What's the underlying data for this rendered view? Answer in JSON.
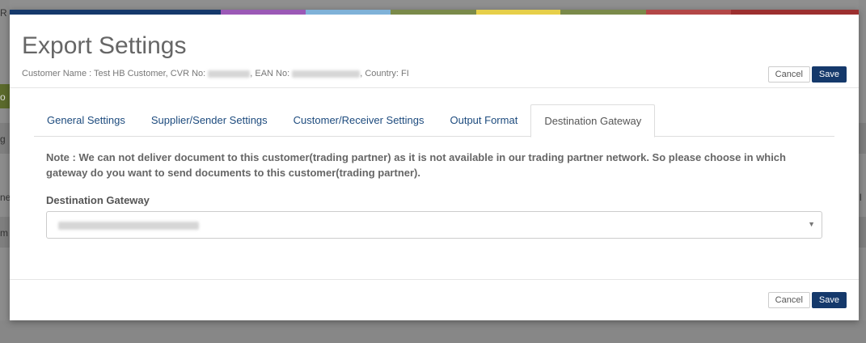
{
  "background": {
    "fragments": [
      "R",
      "o",
      "g",
      "ne",
      "m",
      "l"
    ]
  },
  "modal": {
    "color_bar": [
      "#15396b",
      "#15396b",
      "#9b59b6",
      "#7fb2d8",
      "#7a8a4a",
      "#e6cf4a",
      "#7a8a4a",
      "#b34747",
      "#9c2f2f"
    ],
    "title": "Export Settings",
    "subtitle": {
      "customer_label": "Customer Name : Test HB Customer, CVR No: ",
      "ean_label": ", EAN No: ",
      "country_label": ", Country: FI"
    },
    "header_buttons": {
      "cancel": "Cancel",
      "save": "Save"
    },
    "tabs": [
      {
        "label": "General Settings",
        "active": false
      },
      {
        "label": "Supplier/Sender Settings",
        "active": false
      },
      {
        "label": "Customer/Receiver Settings",
        "active": false
      },
      {
        "label": "Output Format",
        "active": false
      },
      {
        "label": "Destination Gateway",
        "active": true
      }
    ],
    "note": "Note : We can not deliver document to this customer(trading partner) as it is not available in our trading partner network. So please choose in which gateway do you want to send documents to this customer(trading partner).",
    "field_label": "Destination Gateway",
    "select_caret": "▼",
    "footer_buttons": {
      "cancel": "Cancel",
      "save": "Save"
    }
  }
}
